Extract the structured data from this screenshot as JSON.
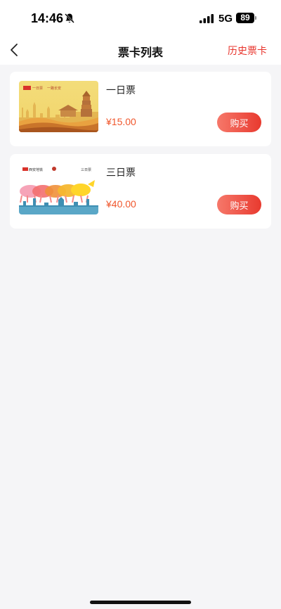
{
  "status_bar": {
    "time": "14:46",
    "network": "5G",
    "battery": "89"
  },
  "nav": {
    "title": "票卡列表",
    "history": "历史票卡"
  },
  "cards": [
    {
      "title": "一日票",
      "price": "¥15.00",
      "buy_label": "购买",
      "image": "xian-one-day-pass-card"
    },
    {
      "title": "三日票",
      "price": "¥40.00",
      "buy_label": "购买",
      "image": "xian-three-day-pass-card"
    }
  ],
  "colors": {
    "accent": "#e8342c",
    "price": "#f0572d",
    "background": "#f5f5f7"
  }
}
